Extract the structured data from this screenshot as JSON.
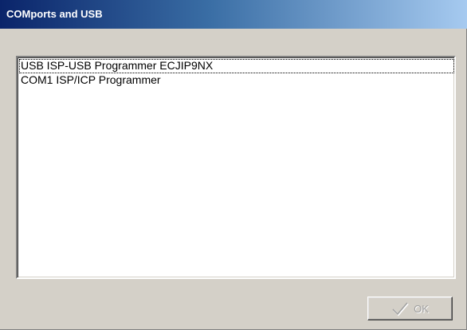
{
  "window": {
    "title": "COMports and USB"
  },
  "list": {
    "items": [
      {
        "label": "USB  ISP-USB Programmer ECJIP9NX"
      },
      {
        "label": "COM1 ISP/ICP Programmer"
      }
    ]
  },
  "buttons": {
    "ok_label": "OK",
    "ok_icon": "checkmark-icon"
  },
  "colors": {
    "title_start": "#0a246a",
    "title_end": "#a6caf0",
    "face": "#d4d0c8"
  }
}
